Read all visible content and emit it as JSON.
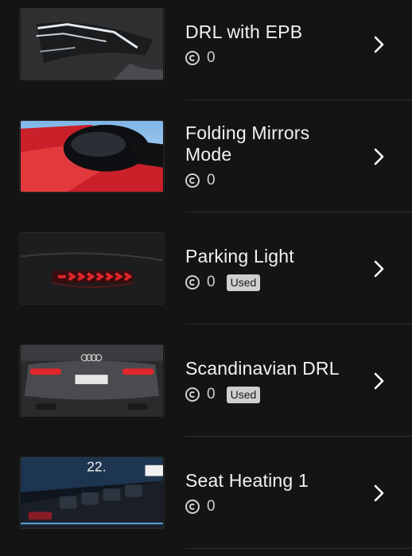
{
  "items": [
    {
      "title": "DRL with EPB",
      "credits": "0",
      "badge": "",
      "thumbnail_icon": "audi-headlight-icon"
    },
    {
      "title": "Folding Mirrors Mode",
      "credits": "0",
      "badge": "",
      "thumbnail_icon": "side-mirror-icon"
    },
    {
      "title": "Parking Light",
      "credits": "0",
      "badge": "Used",
      "thumbnail_icon": "taillight-icon"
    },
    {
      "title": "Scandinavian DRL",
      "credits": "0",
      "badge": "Used",
      "thumbnail_icon": "car-rear-icon"
    },
    {
      "title": "Seat Heating 1",
      "credits": "0",
      "badge": "",
      "thumbnail_icon": "climate-panel-icon"
    }
  ],
  "colors": {
    "background": "#141414",
    "text": "#f2f2f2",
    "muted": "#cfcfcf",
    "divider": "#2e2e2e",
    "taillight_red": "#e0262a"
  }
}
